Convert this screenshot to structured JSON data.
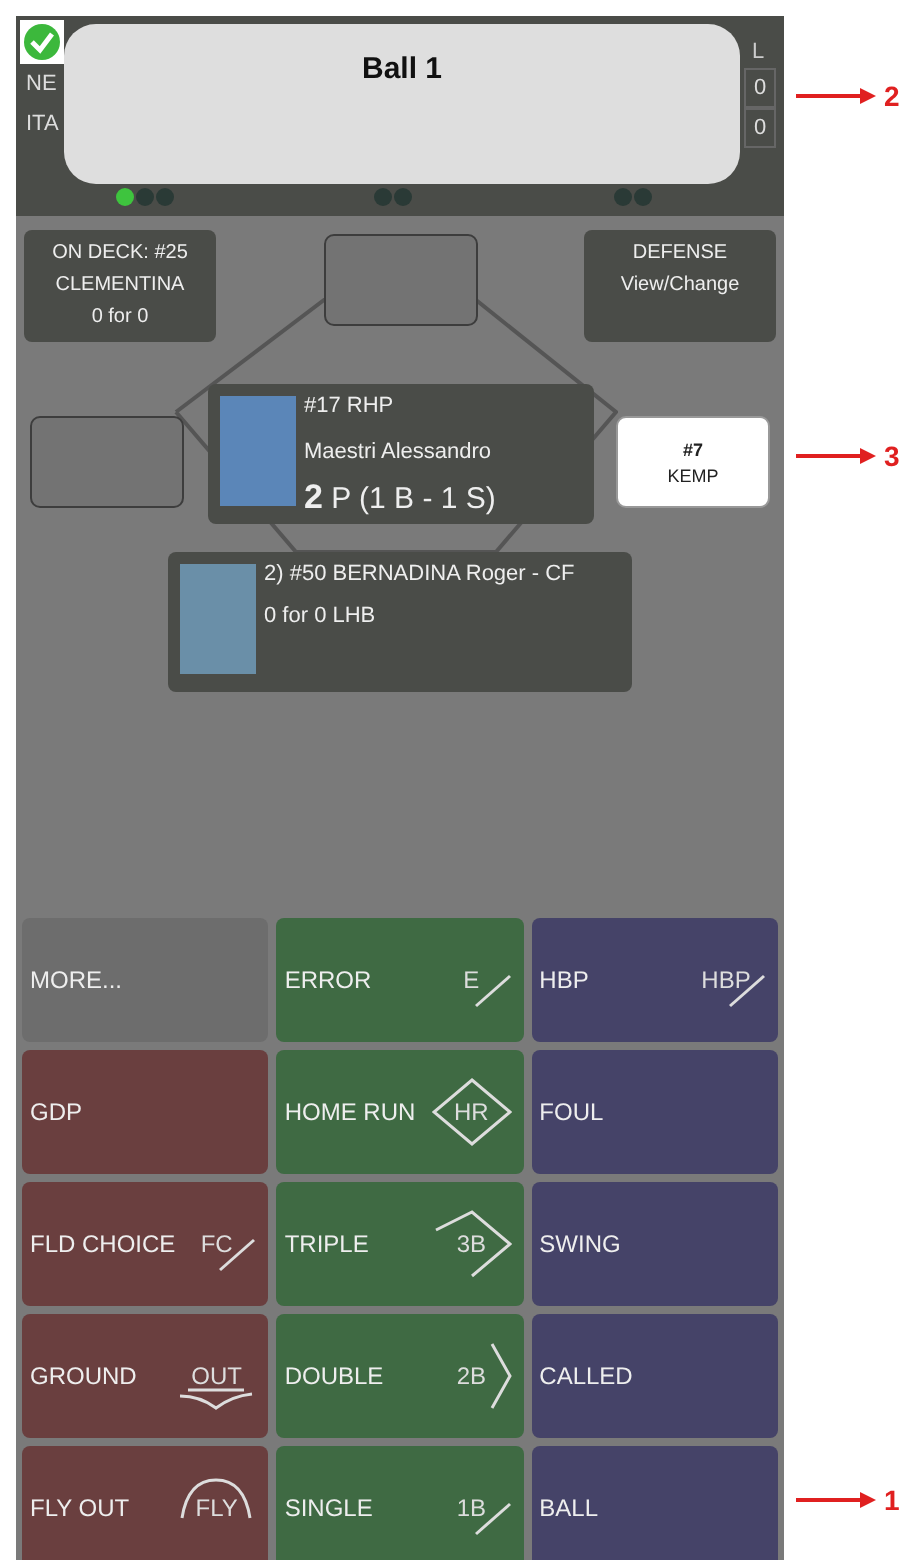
{
  "notification": {
    "message": "Ball 1",
    "success": true
  },
  "scoreboard": {
    "column_header": "L",
    "teams": [
      {
        "name": "NE",
        "total": "0"
      },
      {
        "name": "ITA",
        "total": "0"
      }
    ]
  },
  "count": [
    {
      "kind": "ball",
      "dots": [
        {
          "on": true
        },
        {
          "on": false
        },
        {
          "on": false
        }
      ]
    },
    {
      "kind": "strike",
      "dots": [
        {
          "on": false
        },
        {
          "on": false
        }
      ]
    },
    {
      "kind": "out",
      "dots": [
        {
          "on": false
        },
        {
          "on": false
        }
      ]
    }
  ],
  "field": {
    "on_deck": [
      "ON DECK: #25",
      "CLEMENTINA",
      "0 for 0"
    ],
    "defense": {
      "title": "DEFENSE",
      "action": "View/Change"
    },
    "bases": {
      "second": {
        "occupied": false
      },
      "third": {
        "occupied": false
      },
      "first": {
        "occupied": true,
        "number": "#7",
        "name": "KEMP"
      }
    },
    "pitcher": {
      "title": "#17 RHP",
      "name": "Maestri Alessandro",
      "pitch_count": "2",
      "pitch_detail": "P (1 B - 1 S)"
    },
    "batter": {
      "title": "2) #50 BERNADINA Roger - CF",
      "stats": "0 for 0 LHB"
    }
  },
  "buttons": [
    {
      "label": "MORE...",
      "kind": "other"
    },
    {
      "label": "ERROR",
      "kind": "hit",
      "icon": {
        "kind": "slash",
        "text": "E"
      }
    },
    {
      "label": "HBP",
      "kind": "pitch",
      "icon": {
        "kind": "slash",
        "text": "HBP"
      }
    },
    {
      "label": "GDP",
      "kind": "out"
    },
    {
      "label": "HOME RUN",
      "kind": "hit",
      "icon": {
        "kind": "diamond",
        "text": "HR"
      }
    },
    {
      "label": "FOUL",
      "kind": "pitch"
    },
    {
      "label": "FLD CHOICE",
      "kind": "out",
      "icon": {
        "kind": "slash",
        "text": "FC"
      }
    },
    {
      "label": "TRIPLE",
      "kind": "hit",
      "icon": {
        "kind": "triple",
        "text": "3B"
      }
    },
    {
      "label": "SWING",
      "kind": "pitch"
    },
    {
      "label": "GROUND",
      "kind": "out",
      "icon": {
        "kind": "ground",
        "text": "OUT"
      }
    },
    {
      "label": "DOUBLE",
      "kind": "hit",
      "icon": {
        "kind": "double",
        "text": "2B"
      }
    },
    {
      "label": "CALLED",
      "kind": "pitch"
    },
    {
      "label": "FLY OUT",
      "kind": "out",
      "icon": {
        "kind": "fly",
        "text": "FLY"
      }
    },
    {
      "label": "SINGLE",
      "kind": "hit",
      "icon": {
        "kind": "slash",
        "text": "1B"
      }
    },
    {
      "label": "BALL",
      "kind": "pitch"
    }
  ],
  "callouts": [
    {
      "label": "2"
    },
    {
      "label": "3"
    },
    {
      "label": "1"
    }
  ]
}
